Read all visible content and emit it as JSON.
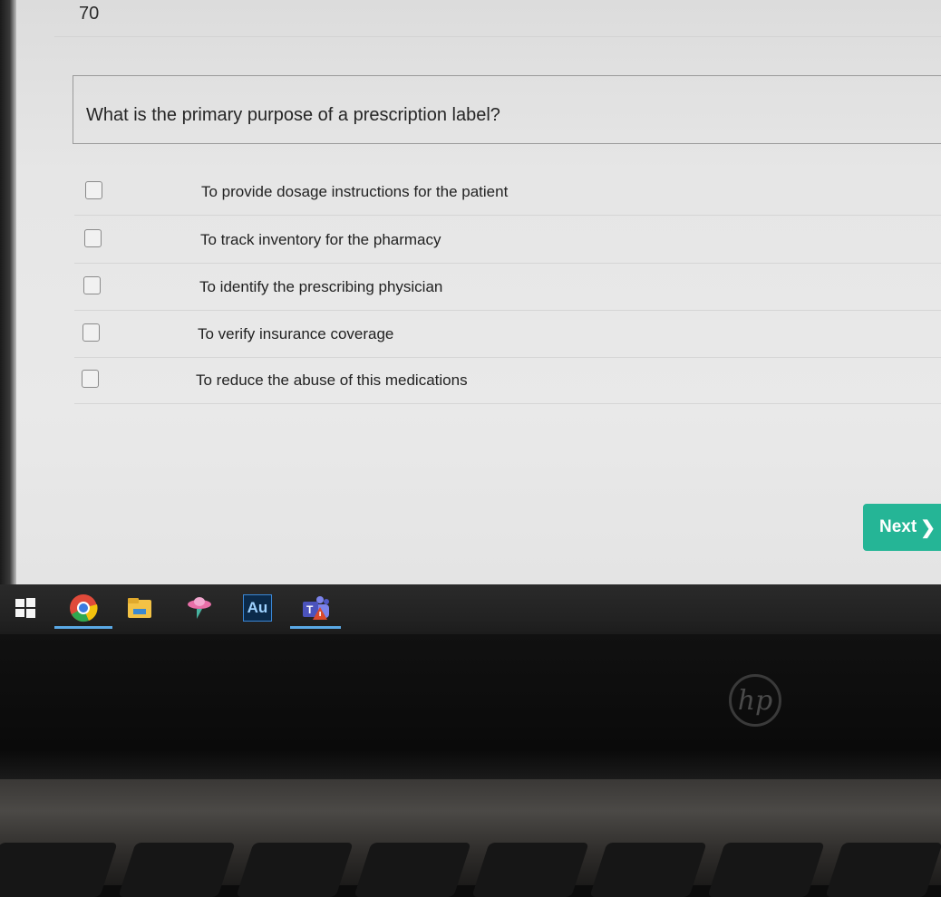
{
  "quiz": {
    "question_number": "70",
    "question": "What is the primary purpose of a prescription label?",
    "options": [
      "To provide dosage instructions for the patient",
      "To track inventory for the pharmacy",
      "To identify the prescribing physician",
      "To verify insurance coverage",
      "To reduce the abuse of this medications"
    ],
    "next_label": "Next",
    "next_chevron": "❯",
    "accent_color": "#25b596"
  },
  "taskbar": {
    "apps": [
      {
        "icon": "windows-start-icon"
      },
      {
        "icon": "chrome-icon"
      },
      {
        "icon": "file-explorer-icon"
      },
      {
        "icon": "app-icon"
      },
      {
        "icon": "audition-icon",
        "label": "Au"
      },
      {
        "icon": "teams-icon"
      }
    ]
  },
  "device": {
    "logo": "hp"
  }
}
